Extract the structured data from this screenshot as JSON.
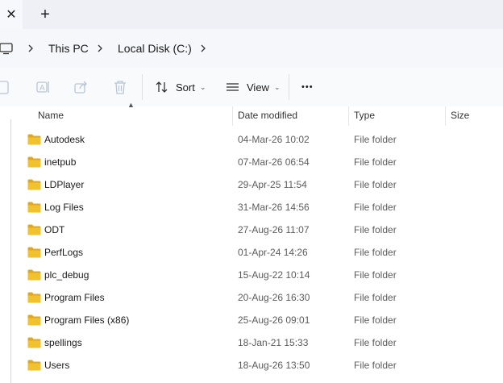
{
  "tabbar": {
    "close_glyph": "✕",
    "new_tab_glyph": "+"
  },
  "breadcrumb": {
    "items": [
      "This PC",
      "Local Disk (C:)"
    ]
  },
  "toolbar": {
    "sort_label": "Sort",
    "view_label": "View",
    "more_glyph": "•••"
  },
  "columns": {
    "name": "Name",
    "date": "Date modified",
    "type": "Type",
    "size": "Size"
  },
  "files": [
    {
      "name": "Autodesk",
      "date": "04-Mar-26 10:02",
      "type": "File folder"
    },
    {
      "name": "inetpub",
      "date": "07-Mar-26 06:54",
      "type": "File folder"
    },
    {
      "name": "LDPlayer",
      "date": "29-Apr-25 11:54",
      "type": "File folder"
    },
    {
      "name": "Log Files",
      "date": "31-Mar-26 14:56",
      "type": "File folder"
    },
    {
      "name": "ODT",
      "date": "27-Aug-26 11:07",
      "type": "File folder"
    },
    {
      "name": "PerfLogs",
      "date": "01-Apr-24 14:26",
      "type": "File folder"
    },
    {
      "name": "plc_debug",
      "date": "15-Aug-22 10:14",
      "type": "File folder"
    },
    {
      "name": "Program Files",
      "date": "20-Aug-26 16:30",
      "type": "File folder"
    },
    {
      "name": "Program Files (x86)",
      "date": "25-Aug-26 09:01",
      "type": "File folder"
    },
    {
      "name": "spellings",
      "date": "18-Jan-21 15:33",
      "type": "File folder"
    },
    {
      "name": "Users",
      "date": "18-Aug-26 13:50",
      "type": "File folder"
    }
  ],
  "colors": {
    "folder": "#f2c12e",
    "folder_dark": "#e0a81c",
    "icon_disabled": "#b9c6d6"
  }
}
